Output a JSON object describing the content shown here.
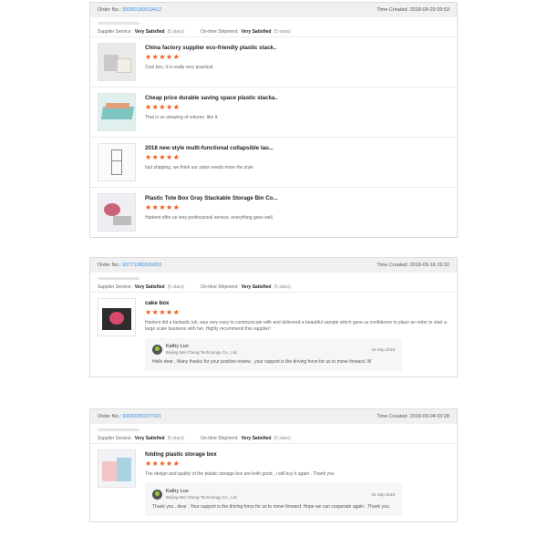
{
  "labels": {
    "order_no": "Order No.:",
    "time_created": "Time Created:",
    "supplier_service": "Supplier Service:",
    "ontime_shipment": "On-time Shipment:"
  },
  "colors": {
    "star": "#f25c19",
    "link": "#3a8ee6"
  },
  "orders": [
    {
      "order_no": "95050190019412",
      "time": "2018-09-29 09:53",
      "supplier_rating": "Very Satisfied",
      "supplier_stars": "(5 stars)",
      "shipment_rating": "Very Satisfied",
      "shipment_stars": "(5 stars)",
      "items": [
        {
          "title": "China factory supplier eco-friendly plastic stack..",
          "stars": "★★★★★",
          "comment": "Cool box, it is really very practical."
        },
        {
          "title": "Cheap price durable saving space plastic stacka..",
          "stars": "★★★★★",
          "comment": "That is so amazing of volume. like it."
        },
        {
          "title": "2018 new style multi-functional collapsible lau...",
          "stars": "★★★★★",
          "comment": "fast shipping, we think our salon needs more the style"
        },
        {
          "title": "Plastic Tote Box Gray Stackable Storage Bin Co...",
          "stars": "★★★★★",
          "comment": "Hanlent offer us very professional service. everything goes well."
        }
      ]
    },
    {
      "order_no": "93771380520053",
      "time": "2018-09-16 19:32",
      "supplier_rating": "Very Satisfied",
      "supplier_stars": "(5 stars)",
      "shipment_rating": "Very Satisfied",
      "shipment_stars": "(5 stars)",
      "items": [
        {
          "title": "cake box",
          "stars": "★★★★★",
          "comment": "Hanlent did a fantastic job, was very easy to communicate with and delivered a beautiful sample which gave us confidence to place an order to start a large scale business with her. Highly recommend this supplier!",
          "reply": {
            "name": "Kathy Luo",
            "company": "Beijing Mei Cheng Technology Co., Ltd.",
            "date": "16 Sep 2018",
            "text": "Hello dear , Many thanks for your positive review , your support is the driving force for us to move forward. W"
          }
        }
      ]
    },
    {
      "order_no": "93592950377601",
      "time": "2018-09-04 03:28",
      "supplier_rating": "Very Satisfied",
      "supplier_stars": "(5 stars)",
      "shipment_rating": "Very Satisfied",
      "shipment_stars": "(5 stars)",
      "items": [
        {
          "title": "folding plastic storage box",
          "stars": "★★★★★",
          "comment": "The design and quality of the plastic storage box are both good , i will buy it again . Thank you",
          "reply": {
            "name": "Kathy Luo",
            "company": "Beijing Mei Cheng Technology Co., Ltd.",
            "date": "04 Sep 2018",
            "text": "Thank you , dear . Your support is the driving force for us to move forward. Hope we can cooperate again . Thank you."
          }
        }
      ]
    }
  ]
}
